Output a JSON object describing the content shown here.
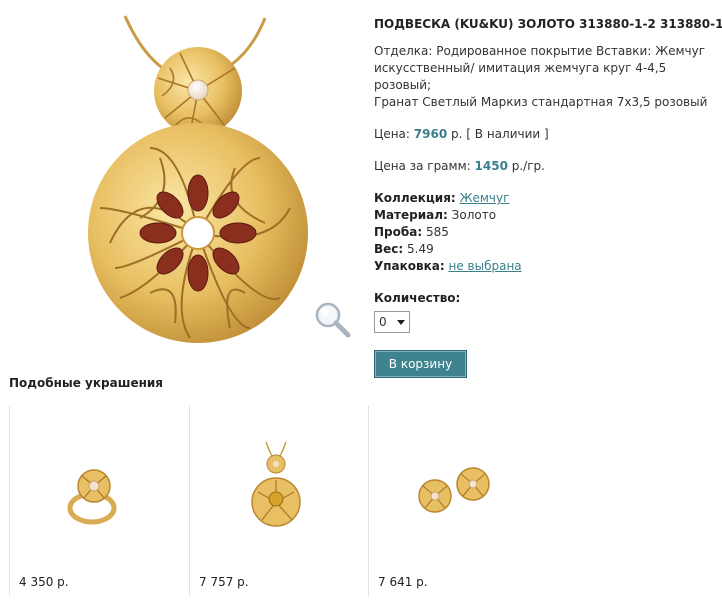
{
  "product": {
    "title": "ПОДВЕСКА (KU&KU) ЗОЛОТО 313880-1-2 313880-1-2",
    "finish_line1": "Отделка: Родированное покрытие Вставки: Жемчуг",
    "finish_line2": "искусственный/ имитация жемчуга круг 4-4,5 розовый;",
    "finish_line3": "Гранат Светлый Маркиз стандартная 7х3,5 розовый",
    "price_label": "Цена:",
    "price_value": "7960",
    "price_currency": "р.",
    "availability": "[ В наличии ]",
    "gram_label": "Цена за грамм:",
    "gram_value": "1450",
    "gram_unit": "р./гр.",
    "collection_label": "Коллекция:",
    "collection_value": "Жемчуг",
    "material_label": "Материал:",
    "material_value": "Золото",
    "probe_label": "Проба:",
    "probe_value": "585",
    "weight_label": "Вес:",
    "weight_value": "5.49",
    "packaging_label": "Упаковка:",
    "packaging_value": "не выбрана",
    "quantity_label": "Количество:",
    "quantity_value": "0",
    "cart_button": "В корзину"
  },
  "similar": {
    "title": "Подобные украшения",
    "items": [
      {
        "price": "4 350 р.",
        "kind": "ring"
      },
      {
        "price": "7 757 р.",
        "kind": "pendant"
      },
      {
        "price": "7 641 р.",
        "kind": "earrings"
      }
    ]
  },
  "icons": {
    "zoom": "magnifier-icon"
  },
  "colors": {
    "accent": "#3a7f8c",
    "button": "#3f8390",
    "gold": "#e2b85c",
    "garnet": "#8a2e1e"
  }
}
